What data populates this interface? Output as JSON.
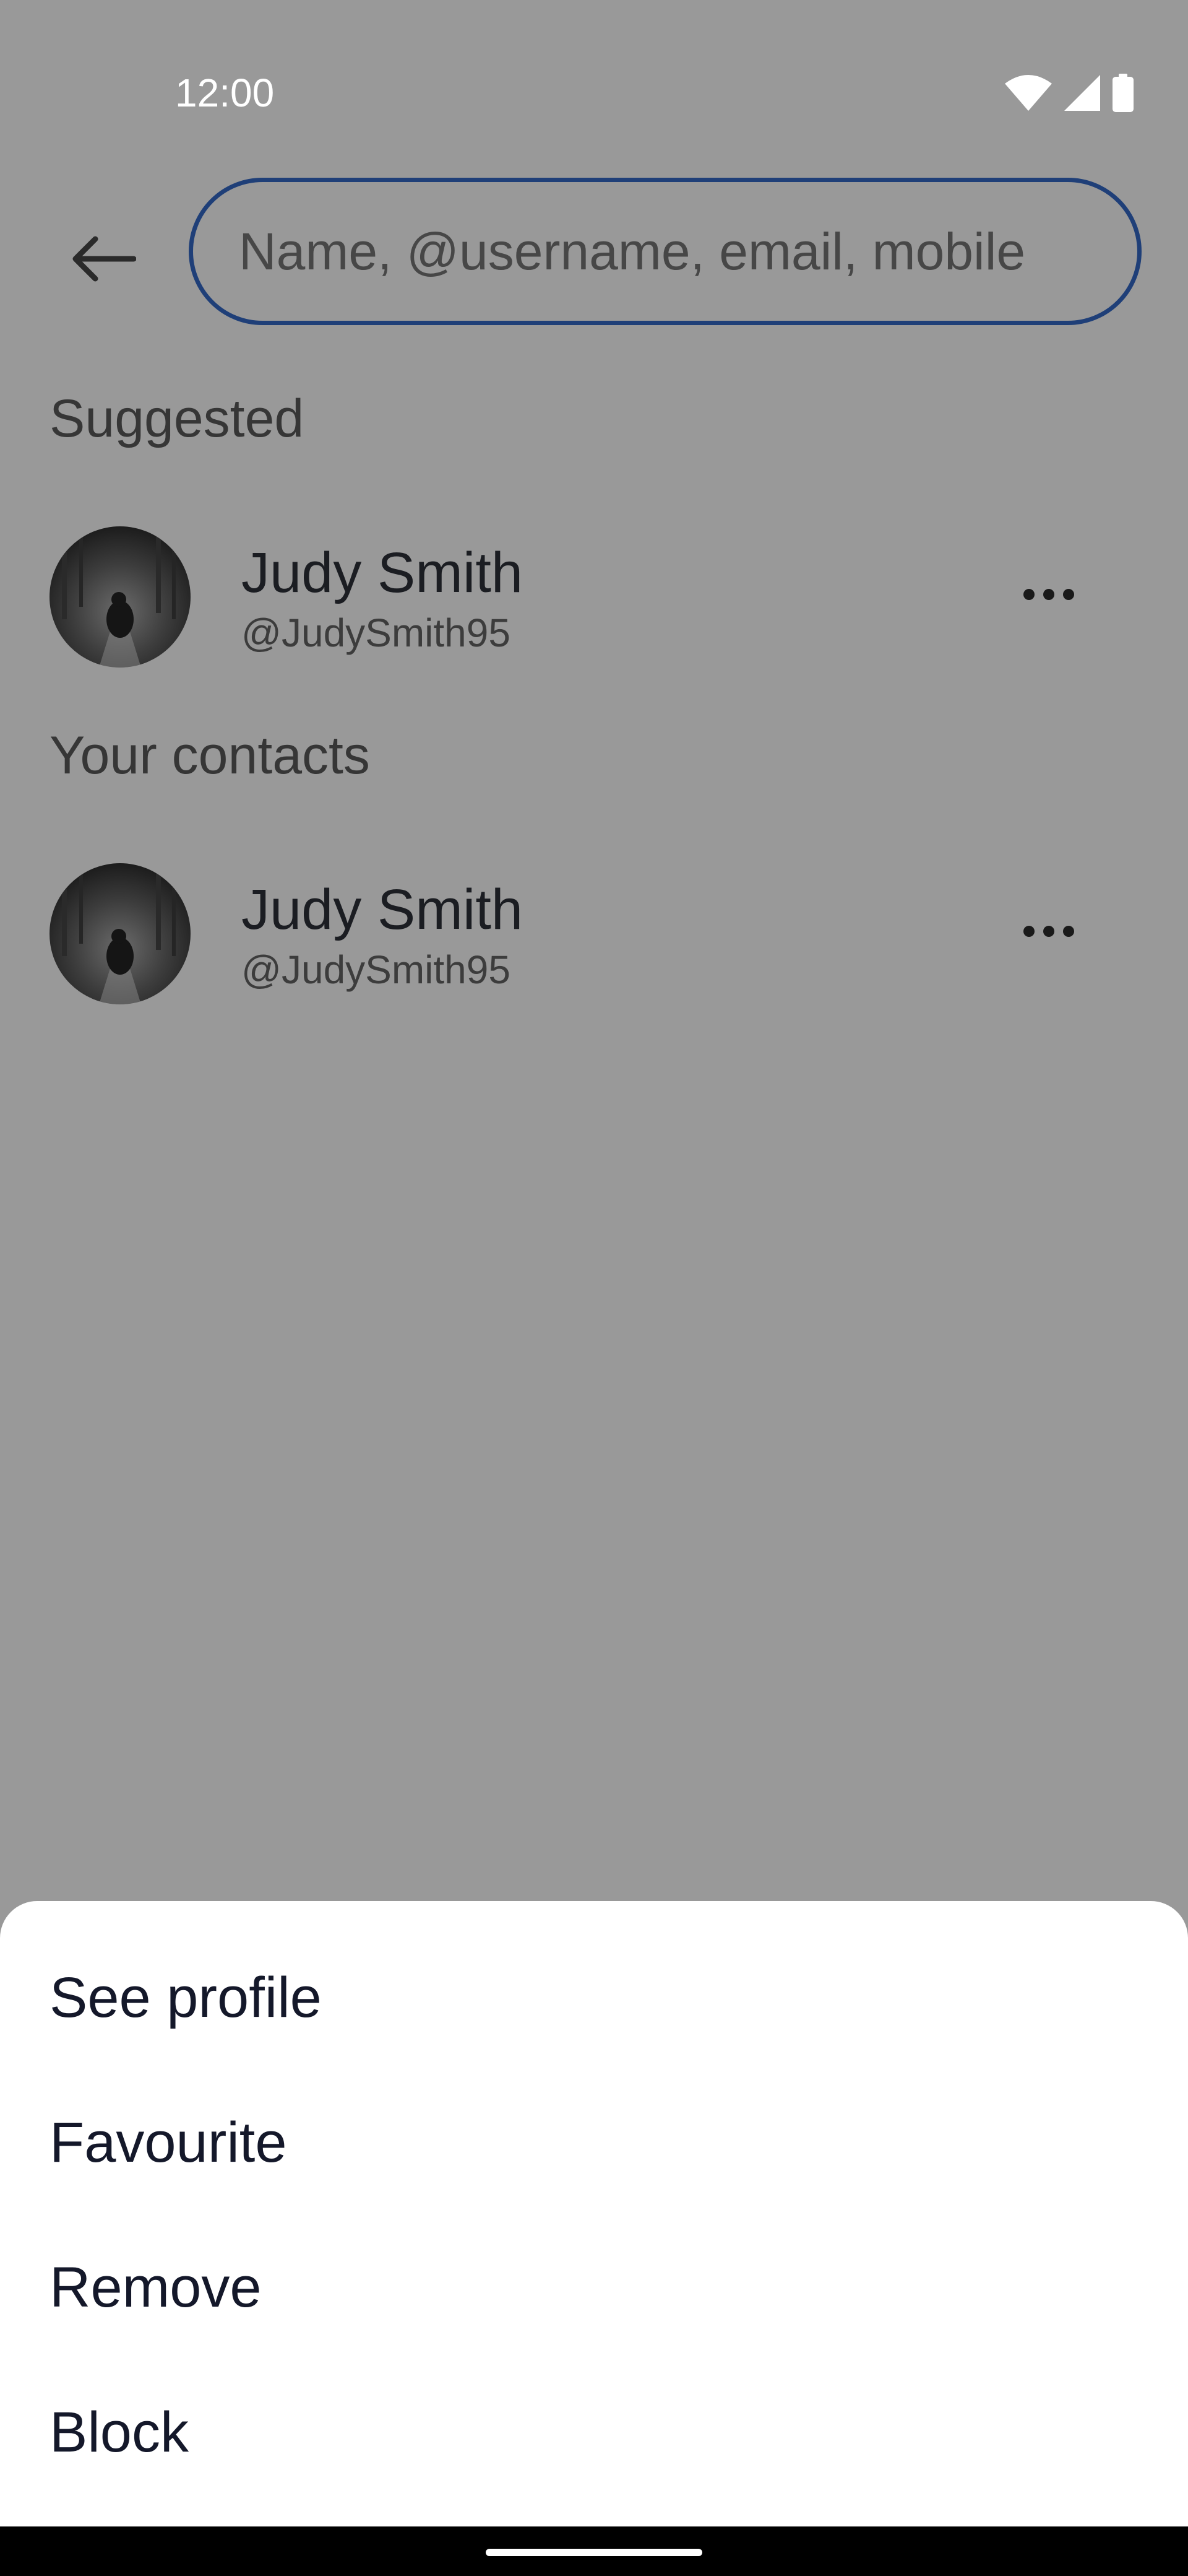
{
  "status_bar": {
    "time": "12:00",
    "icons": [
      "wifi-icon",
      "cellular-signal-icon",
      "battery-icon"
    ]
  },
  "search": {
    "placeholder": "Name, @username, email, mobile"
  },
  "suggested": {
    "heading": "Suggested",
    "items": [
      {
        "name": "Judy Smith",
        "handle": "@JudySmith95"
      }
    ]
  },
  "contacts": {
    "heading": "Your contacts",
    "items": [
      {
        "name": "Judy Smith",
        "handle": "@JudySmith95"
      }
    ]
  },
  "sheet": {
    "items": [
      {
        "label": "See profile"
      },
      {
        "label": "Favourite"
      },
      {
        "label": "Remove"
      },
      {
        "label": "Block"
      }
    ]
  },
  "colors": {
    "scrim_background": "#999999",
    "search_border": "#1f3f78",
    "sheet_background": "#ffffff",
    "sheet_text": "#14182a",
    "nav_bar": "#000000"
  }
}
